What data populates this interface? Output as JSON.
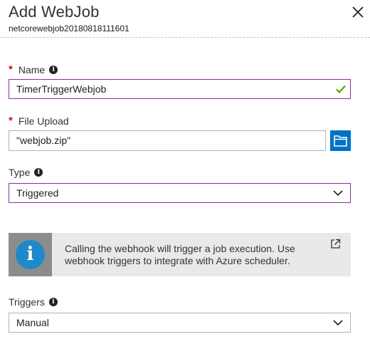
{
  "header": {
    "title": "Add WebJob",
    "subtitle": "netcorewebjob20180818111601",
    "close_icon": "close-icon"
  },
  "form": {
    "name": {
      "required_mark": "*",
      "label": "Name",
      "value": "TimerTriggerWebjob",
      "valid": true
    },
    "file_upload": {
      "required_mark": "*",
      "label": "File Upload",
      "value": "\"webjob.zip\""
    },
    "type": {
      "label": "Type",
      "selected": "Triggered"
    },
    "info": {
      "text": "Calling the webhook will trigger a job execution. Use webhook triggers to integrate with Azure scheduler."
    },
    "triggers": {
      "label": "Triggers",
      "selected": "Manual"
    }
  },
  "colors": {
    "accent": "#0072c6",
    "focus_border": "#8a2da5",
    "required": "#c50f1f",
    "valid_check": "#57a300"
  },
  "icons": [
    "close-icon",
    "info-icon",
    "checkmark-icon",
    "folder-icon",
    "chevron-down-icon",
    "external-link-icon"
  ]
}
